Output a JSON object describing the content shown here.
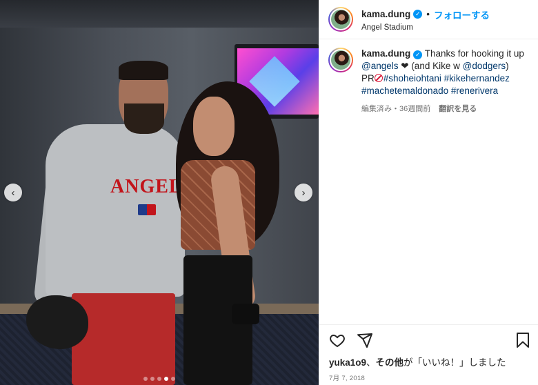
{
  "post": {
    "username": "kama.dung",
    "follow_label": "フォローする",
    "separator": "•",
    "location": "Angel Stadium",
    "verified_glyph": "✓"
  },
  "caption": {
    "username": "kama.dung",
    "text1": " Thanks for hooking it up ",
    "tag_angels": "@angels",
    "heart": " ❤",
    "text2": " (and Kike w ",
    "tag_dodgers": "@dodgers",
    "text3": ")",
    "pr": "PR",
    "hashtags": [
      "#shoheiohtani",
      "#kikehernandez",
      "#machetemaldonado",
      "#renerivera"
    ]
  },
  "meta": {
    "edited": "編集済み・36週間前",
    "see_translation": "翻訳を見る"
  },
  "photo": {
    "shirt_text": "ANGELS",
    "prev_glyph": "‹",
    "next_glyph": "›",
    "dots_total": 5,
    "dots_active_index": 3
  },
  "actions": {
    "like_icon": "heart-outline-icon",
    "share_icon": "paper-plane-icon",
    "save_icon": "bookmark-icon"
  },
  "likes": {
    "user": "yuka1o9",
    "comma": "、",
    "others": "その他",
    "rest": "が「いいね！」しました"
  },
  "date": "7月 7, 2018",
  "colors": {
    "link": "#00376b",
    "follow": "#0095f6",
    "muted": "#737373"
  }
}
